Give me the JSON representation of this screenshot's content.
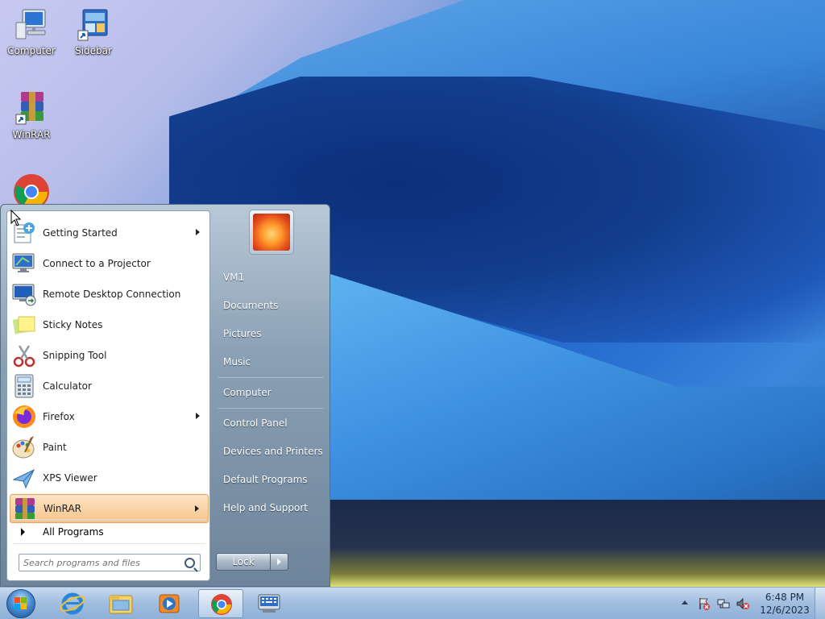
{
  "desktop": {
    "icons": [
      {
        "label": "Computer",
        "icon": "computer-icon"
      },
      {
        "label": "Sidebar",
        "icon": "sidebar-shortcut-icon"
      },
      {
        "label": "WinRAR",
        "icon": "winrar-shortcut-icon"
      },
      {
        "label": "",
        "icon": "chrome-icon"
      }
    ]
  },
  "start_menu": {
    "programs": [
      {
        "label": "Getting Started",
        "icon": "getting-started-icon",
        "submenu": true
      },
      {
        "label": "Connect to a Projector",
        "icon": "projector-icon",
        "submenu": false
      },
      {
        "label": "Remote Desktop Connection",
        "icon": "remote-desktop-icon",
        "submenu": false
      },
      {
        "label": "Sticky Notes",
        "icon": "sticky-notes-icon",
        "submenu": false
      },
      {
        "label": "Snipping Tool",
        "icon": "snipping-tool-icon",
        "submenu": false
      },
      {
        "label": "Calculator",
        "icon": "calculator-icon",
        "submenu": false
      },
      {
        "label": "Firefox",
        "icon": "firefox-icon",
        "submenu": true
      },
      {
        "label": "Paint",
        "icon": "paint-icon",
        "submenu": false
      },
      {
        "label": "XPS Viewer",
        "icon": "xps-viewer-icon",
        "submenu": false
      },
      {
        "label": "WinRAR",
        "icon": "winrar-icon",
        "submenu": true,
        "highlighted": true
      }
    ],
    "all_programs": "All Programs",
    "search_placeholder": "Search programs and files",
    "right_links": [
      "VM1",
      "Documents",
      "Pictures",
      "Music",
      "Computer",
      "Control Panel",
      "Devices and Printers",
      "Default Programs",
      "Help and Support"
    ],
    "lock_label": "Lock"
  },
  "taskbar": {
    "pinned": [
      "internet-explorer-icon",
      "windows-explorer-icon",
      "media-player-icon",
      "chrome-icon",
      "on-screen-keyboard-icon"
    ],
    "active": "chrome-icon",
    "clock_time": "6:48 PM",
    "clock_date": "12/6/2023"
  },
  "colors": {
    "highlight": "#f6c58b",
    "taskbar": "#a3bfe0",
    "start_right_pane": "#8aa0b5"
  }
}
